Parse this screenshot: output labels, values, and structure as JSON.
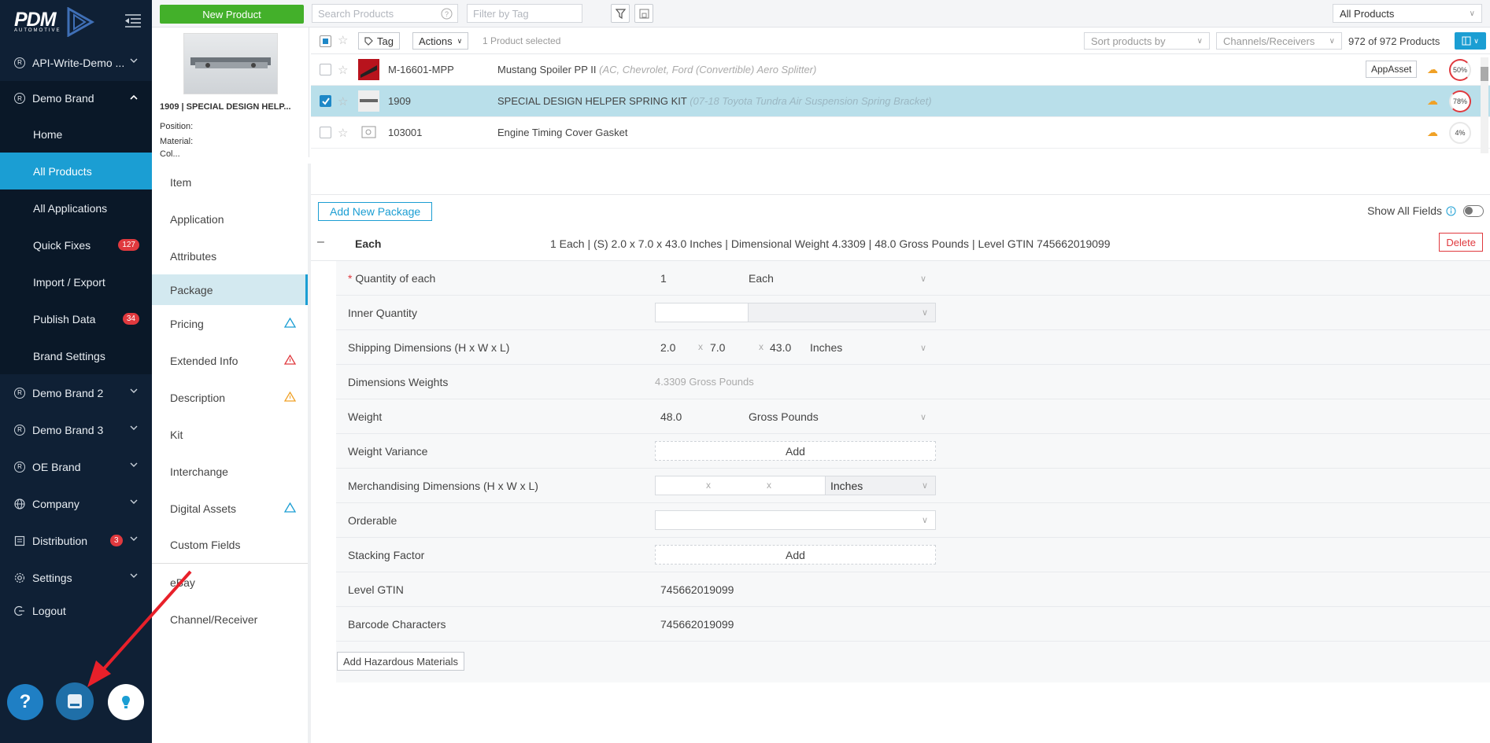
{
  "brand": {
    "logo_text": "PDM",
    "logo_sub": "AUTOMOTIVE"
  },
  "sidebar": {
    "items": [
      {
        "label": "API-Write-Demo ...",
        "icon": "registered-icon",
        "chevron": "down"
      },
      {
        "label": "Demo Brand",
        "icon": "registered-icon",
        "chevron": "up"
      },
      {
        "label": "Home"
      },
      {
        "label": "All Products"
      },
      {
        "label": "All Applications"
      },
      {
        "label": "Quick Fixes",
        "badge": "127"
      },
      {
        "label": "Import / Export"
      },
      {
        "label": "Publish Data",
        "badge": "34"
      },
      {
        "label": "Brand Settings"
      },
      {
        "label": "Demo Brand 2",
        "icon": "registered-icon",
        "chevron": "down"
      },
      {
        "label": "Demo Brand 3",
        "icon": "registered-icon",
        "chevron": "down"
      },
      {
        "label": "OE Brand",
        "icon": "registered-icon",
        "chevron": "down"
      },
      {
        "label": "Company",
        "icon": "globe-icon",
        "chevron": "down"
      },
      {
        "label": "Distribution",
        "icon": "distribution-icon",
        "chevron": "down",
        "badge": "3"
      },
      {
        "label": "Settings",
        "icon": "gear-icon",
        "chevron": "down"
      },
      {
        "label": "Logout",
        "icon": "logout-icon"
      }
    ],
    "help": {
      "question": "?"
    }
  },
  "toolbar": {
    "new_product": "New Product",
    "search_placeholder": "Search Products",
    "tag_placeholder": "Filter by Tag",
    "view_select": "All Products"
  },
  "product": {
    "title": "1909 | SPECIAL DESIGN HELP...",
    "position_label": "Position:",
    "material_label": "Material:",
    "color_label": "Col..."
  },
  "list": {
    "tag_button": "Tag",
    "actions_button": "Actions",
    "selected_text": "1 Product selected",
    "sort_placeholder": "Sort products by",
    "channels_placeholder": "Channels/Receivers",
    "count": "972 of 972 Products",
    "rows": [
      {
        "number": "M-16601-MPP",
        "name": "Mustang Spoiler PP II",
        "desc": "(AC, Chevrolet, Ford (Convertible) Aero Splitter)",
        "badge": "AppAsset",
        "percent": "50%",
        "selected": false
      },
      {
        "number": "1909",
        "name": "SPECIAL DESIGN HELPER SPRING KIT",
        "desc": "(07-18 Toyota Tundra Air Suspension Spring Bracket)",
        "percent": "78%",
        "selected": true
      },
      {
        "number": "103001",
        "name": "Engine Timing Cover Gasket",
        "desc": "",
        "percent": "4%",
        "selected": false
      }
    ]
  },
  "tabs": [
    {
      "label": "Item"
    },
    {
      "label": "Application"
    },
    {
      "label": "Attributes"
    },
    {
      "label": "Package",
      "active": true
    },
    {
      "label": "Pricing",
      "warn": "blue"
    },
    {
      "label": "Extended Info",
      "warn": "red"
    },
    {
      "label": "Description",
      "warn": "orange"
    },
    {
      "label": "Kit"
    },
    {
      "label": "Interchange"
    },
    {
      "label": "Digital Assets",
      "warn": "blue"
    },
    {
      "label": "Custom Fields"
    },
    {
      "label": "eBay"
    },
    {
      "label": "Channel/Receiver"
    }
  ],
  "package": {
    "add_new": "Add New Package",
    "show_all": "Show All Fields",
    "header_name": "Each",
    "header_summary": "1 Each | (S) 2.0 x 7.0 x 43.0 Inches | Dimensional Weight 4.3309 | 48.0 Gross Pounds | Level GTIN 745662019099",
    "delete": "Delete",
    "fields": {
      "qty_label": "Quantity of each",
      "qty_value": "1",
      "qty_unit": "Each",
      "inner_label": "Inner Quantity",
      "ship_label": "Shipping Dimensions (H x W x L)",
      "ship_h": "2.0",
      "ship_w": "7.0",
      "ship_l": "43.0",
      "ship_unit": "Inches",
      "x": "x",
      "dimw_label": "Dimensions Weights",
      "dimw_value": "4.3309 Gross Pounds",
      "weight_label": "Weight",
      "weight_value": "48.0",
      "weight_unit": "Gross Pounds",
      "wvar_label": "Weight Variance",
      "add": "Add",
      "merch_label": "Merchandising Dimensions (H x W x L)",
      "merch_unit": "Inches",
      "orderable_label": "Orderable",
      "stack_label": "Stacking Factor",
      "gtin_label": "Level GTIN",
      "gtin_value": "745662019099",
      "barcode_label": "Barcode Characters",
      "barcode_value": "745662019099"
    },
    "hazardous": "Add Hazardous Materials"
  },
  "colors": {
    "sidebar": "#0f2035",
    "accent": "#1b9ed3",
    "green": "#43b02a",
    "danger": "#e0393e",
    "arrow": "#e8202a"
  }
}
